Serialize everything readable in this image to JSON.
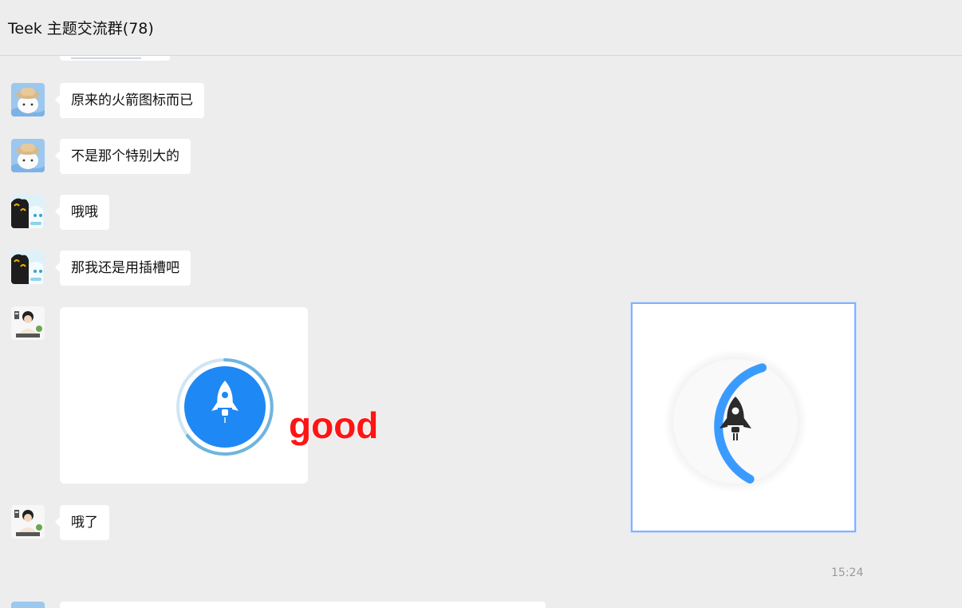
{
  "header": {
    "title": "Teek 主题交流群(78)"
  },
  "messages": [
    {
      "avatar": "hat-cat-avatar",
      "text": "原来的火箭图标而已"
    },
    {
      "avatar": "hat-cat-avatar",
      "text": "不是那个特别大的"
    },
    {
      "avatar": "cats-avatar",
      "text": "哦哦"
    },
    {
      "avatar": "cats-avatar",
      "text": "那我还是用插槽吧"
    },
    {
      "avatar": "person-desk-avatar",
      "type": "image",
      "overlay_text": "good"
    },
    {
      "avatar": "person-desk-avatar",
      "text": "哦了"
    }
  ],
  "timestamp": "15:24",
  "colors": {
    "background": "#ededed",
    "bubble": "#ffffff",
    "rocket_blue": "#1e88f5",
    "ring_blue": "#3a9bff",
    "good_red": "#ff1414",
    "preview_border": "#7fb2ff"
  },
  "icons": [
    "rocket-icon",
    "rocket-icon-dark"
  ]
}
